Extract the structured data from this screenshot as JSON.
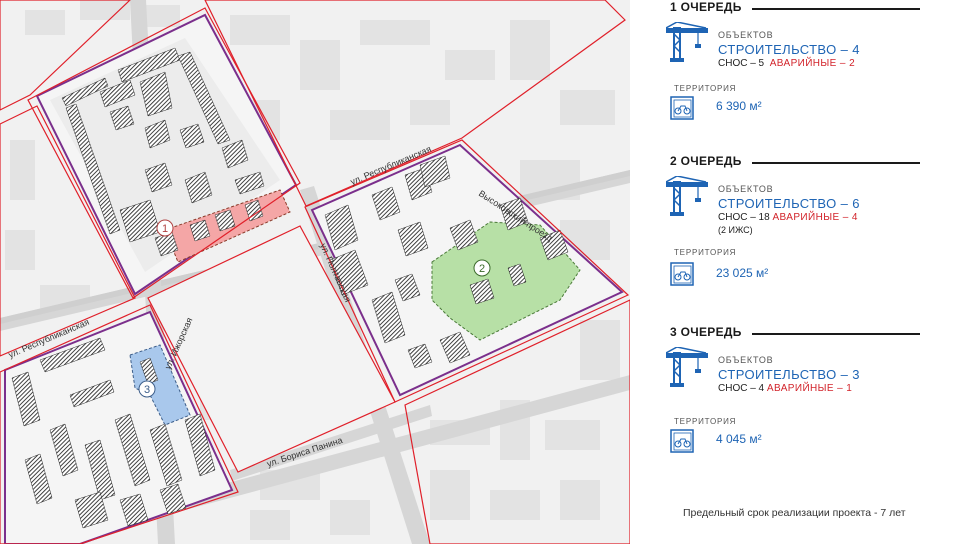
{
  "map": {
    "streets": [
      "ул. Республиканская",
      "ул. Республиканская",
      "ул. Полтавская",
      "Высоковский проезд",
      "ул. Ижорская",
      "ул. Бориса Панина"
    ],
    "markers": [
      "1",
      "2",
      "3"
    ],
    "colors": {
      "block_outline": "#e0202a",
      "project_outline": "#7b2f8c",
      "zone1": "#f4a6a6",
      "zone2": "#b7e0a6",
      "zone3": "#a9c8ec",
      "road": "#d9d9d9",
      "building_hatch": "#2b2b2b"
    }
  },
  "phases": [
    {
      "title": "1 ОЧЕРЕДЬ",
      "objects_label": "ОБЪЕКТОВ",
      "build": "СТРОИТЕЛЬСТВО – 4",
      "demo": "СНОС – 5",
      "emergency": "АВАРИЙНЫЕ – 2",
      "izhs": "",
      "territory_label": "ТЕРРИТОРИЯ",
      "territory_value": "6 390 м²"
    },
    {
      "title": "2 ОЧЕРЕДЬ",
      "objects_label": "ОБЪЕКТОВ",
      "build": "СТРОИТЕЛЬСТВО – 6",
      "demo": "СНОС – 18",
      "emergency": "АВАРИЙНЫЕ – 4",
      "izhs": "(2 ИЖС)",
      "territory_label": "ТЕРРИТОРИЯ",
      "territory_value": "23 025 м²"
    },
    {
      "title": "3 ОЧЕРЕДЬ",
      "objects_label": "ОБЪЕКТОВ",
      "build": "СТРОИТЕЛЬСТВО – 3",
      "demo": "СНОС – 4",
      "emergency": "АВАРИЙНЫЕ – 1",
      "izhs": "",
      "territory_label": "ТЕРРИТОРИЯ",
      "territory_value": "4 045 м²"
    }
  ],
  "icons": {
    "crane": "crane-icon",
    "territory": "bicycle-territory-icon"
  },
  "deadline": "Предельный срок реализации проекта - 7 лет"
}
